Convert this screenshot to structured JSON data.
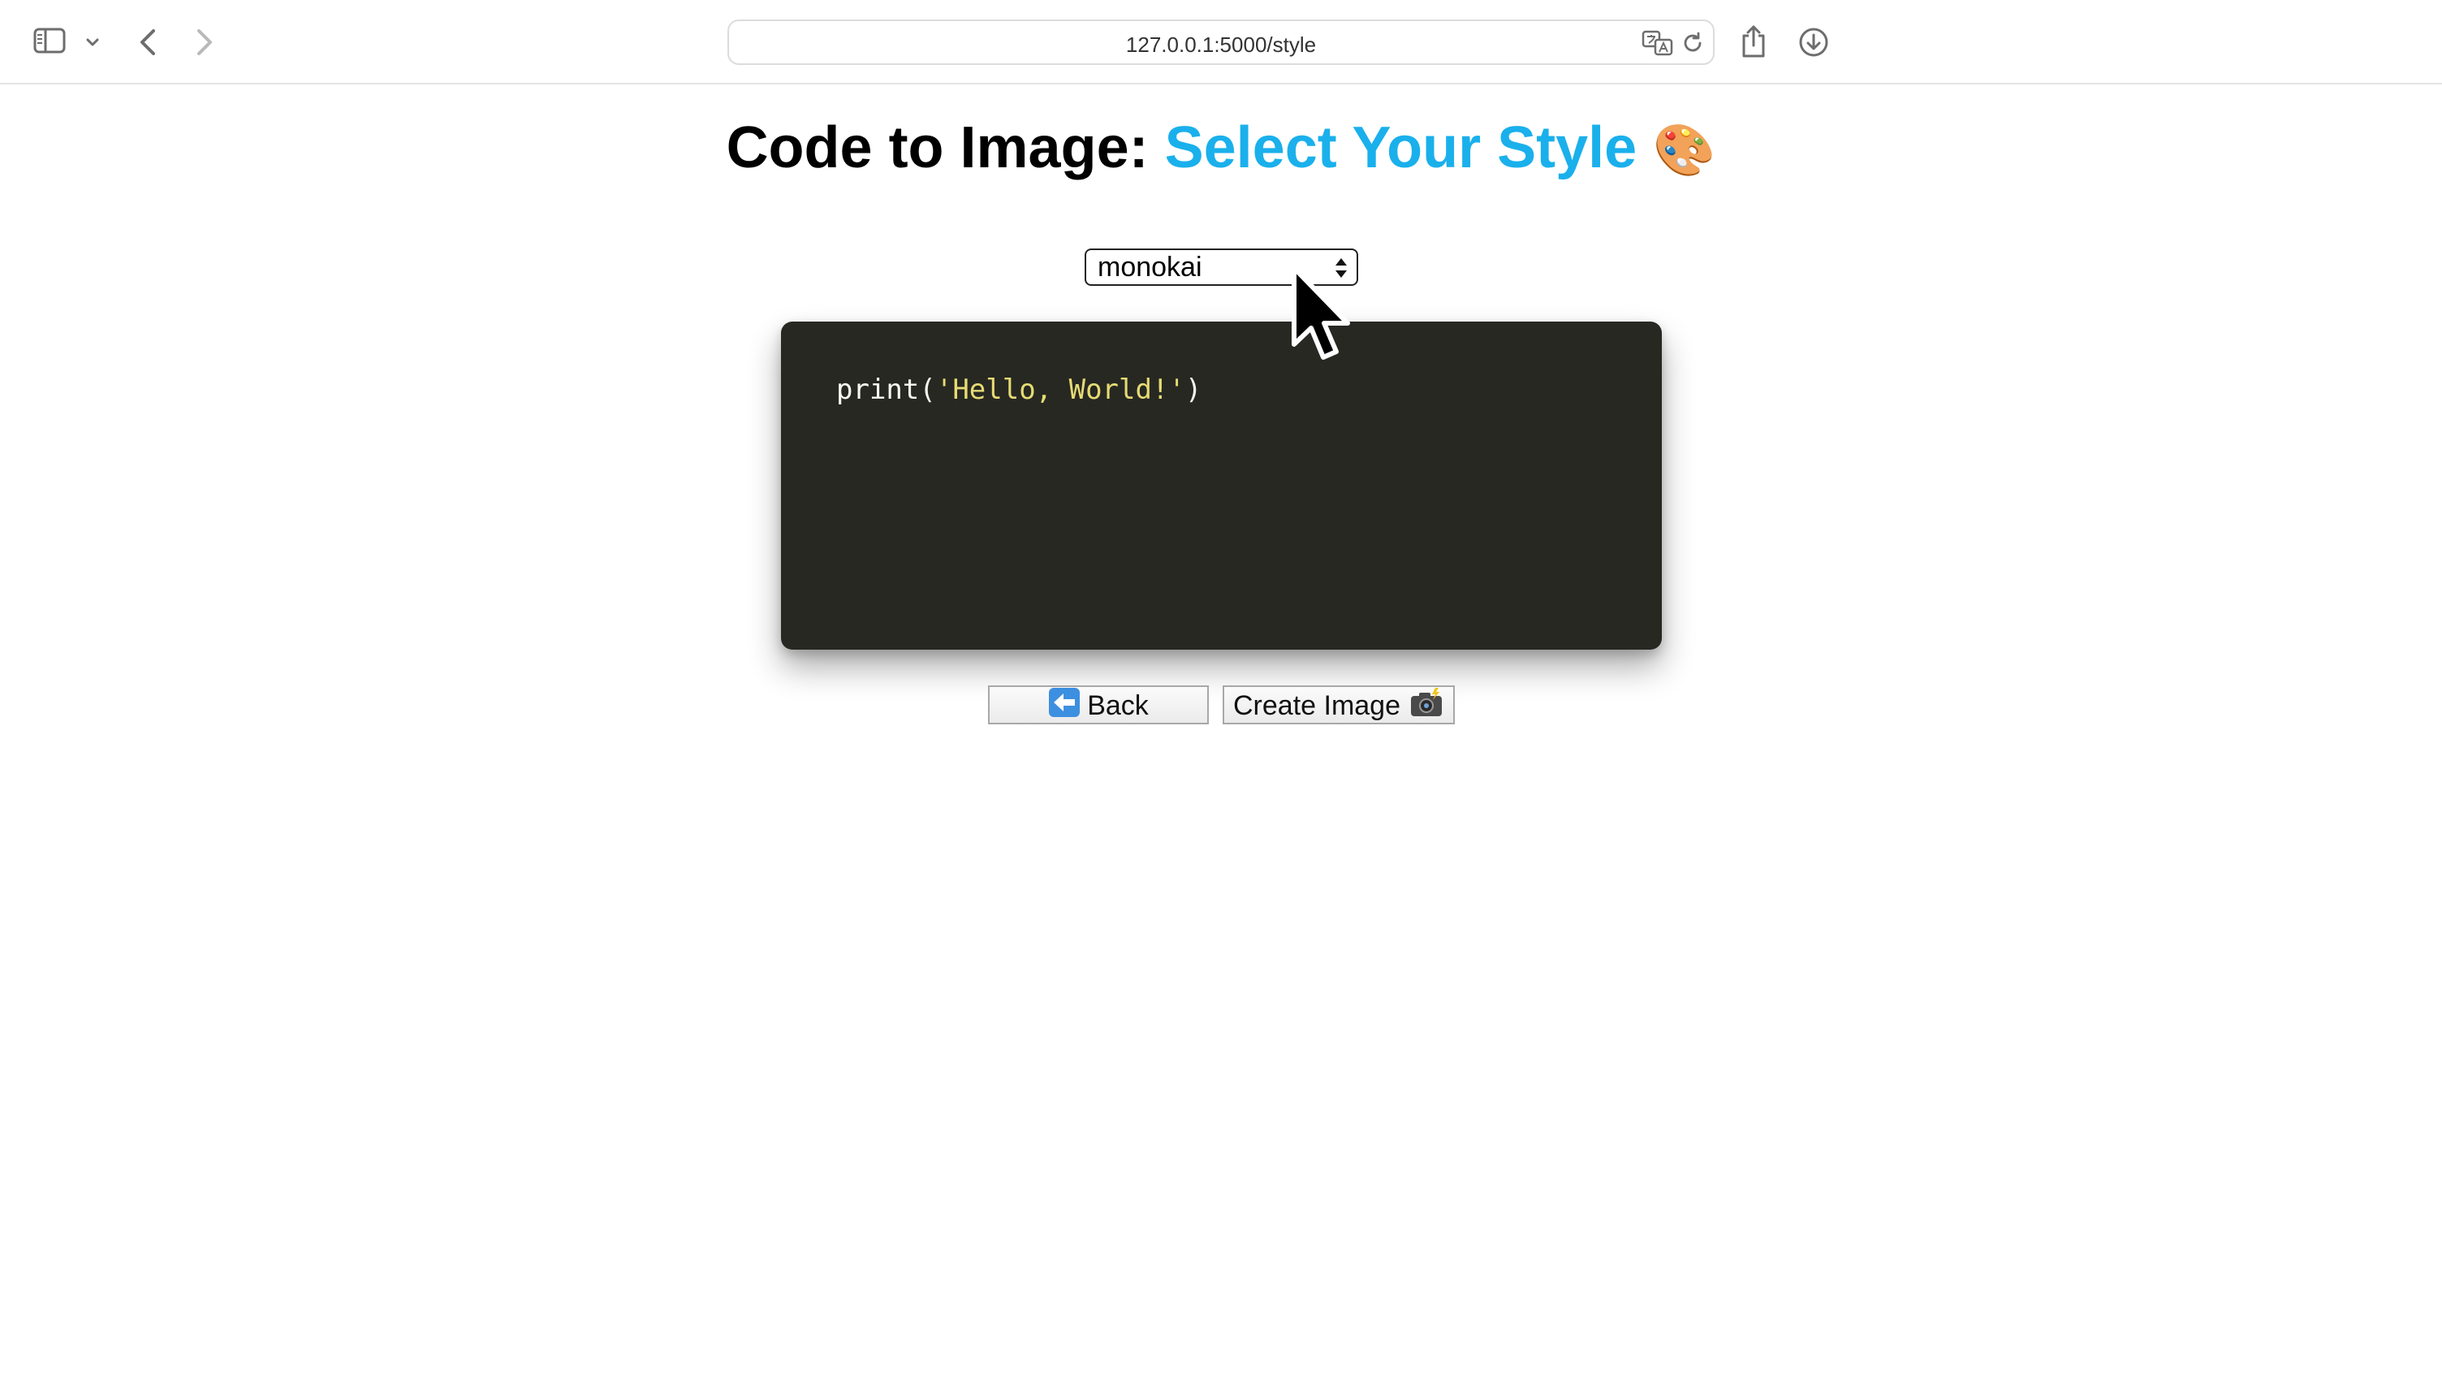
{
  "browser": {
    "url": "127.0.0.1:5000/style"
  },
  "page": {
    "title_prefix": "Code to Image: ",
    "title_accent": "Select Your Style",
    "title_emoji": "🎨",
    "accent_color": "#1ab0ec"
  },
  "style_select": {
    "selected": "monokai"
  },
  "code": {
    "func": "print",
    "open": "(",
    "string": "'Hello, World!'",
    "close": ")",
    "background": "#272822",
    "string_color": "#e6db74"
  },
  "buttons": {
    "back_label": "Back",
    "create_label": "Create Image"
  }
}
